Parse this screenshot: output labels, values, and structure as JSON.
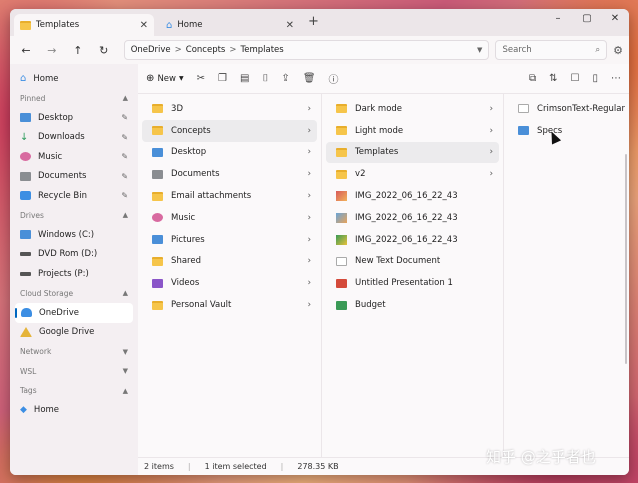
{
  "tabs": [
    {
      "label": "Templates",
      "active": true
    },
    {
      "label": "Home",
      "active": false
    }
  ],
  "new_tab_symbol": "+",
  "window_controls": [
    "–",
    "▢",
    "✕"
  ],
  "nav": {
    "back": "←",
    "forward": "→",
    "up": "↑",
    "refresh": "↻"
  },
  "address": {
    "crumbs": [
      "OneDrive",
      "Concepts",
      "Templates"
    ],
    "separator": ">"
  },
  "search": {
    "placeholder": "Search"
  },
  "toolbar": {
    "new_label": "New"
  },
  "sidebar": {
    "home": "Home",
    "pinned_header": "Pinned",
    "pinned": [
      "Desktop",
      "Downloads",
      "Music",
      "Documents",
      "Recycle Bin"
    ],
    "drives_header": "Drives",
    "drives": [
      "Windows (C:)",
      "DVD Rom (D:)",
      "Projects (P:)"
    ],
    "cloud_header": "Cloud Storage",
    "cloud": [
      "OneDrive",
      "Google Drive"
    ],
    "network_header": "Network",
    "wsl_header": "WSL",
    "tags_header": "Tags",
    "tags_home": "Home"
  },
  "columns": [
    [
      "3D",
      "Concepts",
      "Desktop",
      "Documents",
      "Email attachments",
      "Music",
      "Pictures",
      "Shared",
      "Videos",
      "Personal Vault"
    ],
    [
      "Dark mode",
      "Light mode",
      "Templates",
      "v2",
      "IMG_2022_06_16_22_43",
      "IMG_2022_06_16_22_43",
      "IMG_2022_06_16_22_43",
      "New Text Document",
      "Untitled Presentation 1",
      "Budget"
    ],
    [
      "CrimsonText-Regular",
      "Specs"
    ]
  ],
  "status": {
    "items": "2 items",
    "selected": "1 item selected",
    "size": "278.35 KB"
  },
  "watermark": "知乎 @之乎者也",
  "colors": {
    "accent": "#0067c0",
    "folder": "#f6c54a"
  }
}
